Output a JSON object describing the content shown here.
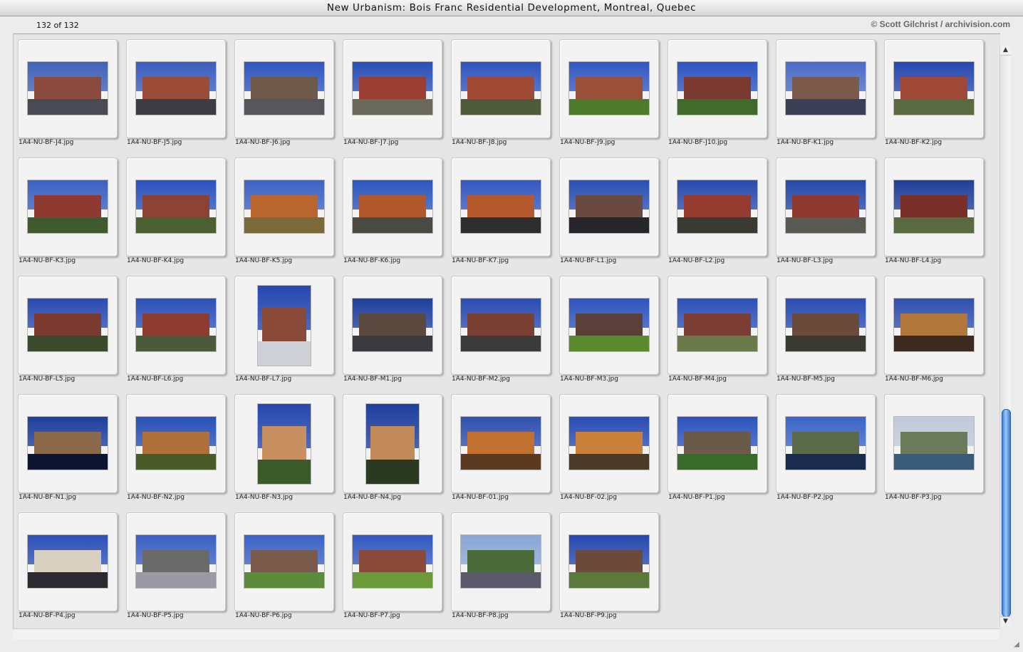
{
  "window": {
    "title": "New Urbanism: Bois Franc Residential Development, Montreal, Quebec"
  },
  "info": {
    "count": "132 of 132",
    "credit": "© Scott Gilchrist / archivision.com"
  },
  "thumbnails": [
    {
      "name": "1A4-NU-BF-J4.jpg",
      "sky": "#3f62b8",
      "bld": "#8a4a3c",
      "grd": "#4a4a55",
      "o": "land"
    },
    {
      "name": "1A4-NU-BF-J5.jpg",
      "sky": "#3a5ec0",
      "bld": "#9a4c38",
      "grd": "#3c3c42",
      "o": "land"
    },
    {
      "name": "1A4-NU-BF-J6.jpg",
      "sky": "#2f56c0",
      "bld": "#6d5a4a",
      "grd": "#55555a",
      "o": "land"
    },
    {
      "name": "1A4-NU-BF-J7.jpg",
      "sky": "#2a4fb5",
      "bld": "#9b3f32",
      "grd": "#6a6a5a",
      "o": "land"
    },
    {
      "name": "1A4-NU-BF-J8.jpg",
      "sky": "#2e55bf",
      "bld": "#a04a35",
      "grd": "#4e5a3a",
      "o": "land"
    },
    {
      "name": "1A4-NU-BF-J9.jpg",
      "sky": "#3358c2",
      "bld": "#9a5038",
      "grd": "#4f7a2e",
      "o": "land"
    },
    {
      "name": "1A4-NU-BF-J10.jpg",
      "sky": "#2c55c4",
      "bld": "#7a3a30",
      "grd": "#3f6a2a",
      "o": "land"
    },
    {
      "name": "1A4-NU-BF-K1.jpg",
      "sky": "#4a6cc8",
      "bld": "#7a5a4a",
      "grd": "#3b3f55",
      "o": "land"
    },
    {
      "name": "1A4-NU-BF-K2.jpg",
      "sky": "#2548b0",
      "bld": "#a04836",
      "grd": "#5a6a40",
      "o": "land"
    },
    {
      "name": "1A4-NU-BF-K3.jpg",
      "sky": "#3a60c4",
      "bld": "#8e3a30",
      "grd": "#3e5a2e",
      "o": "land"
    },
    {
      "name": "1A4-NU-BF-K4.jpg",
      "sky": "#2b52bd",
      "bld": "#8a4234",
      "grd": "#4a6032",
      "o": "land"
    },
    {
      "name": "1A4-NU-BF-K5.jpg",
      "sky": "#3c62c6",
      "bld": "#b8662e",
      "grd": "#7a6a3a",
      "o": "land"
    },
    {
      "name": "1A4-NU-BF-K6.jpg",
      "sky": "#2e56c0",
      "bld": "#b0582a",
      "grd": "#4a4a45",
      "o": "land"
    },
    {
      "name": "1A4-NU-BF-K7.jpg",
      "sky": "#3358c2",
      "bld": "#b45a2c",
      "grd": "#2e2e30",
      "o": "land"
    },
    {
      "name": "1A4-NU-BF-L1.jpg",
      "sky": "#2b4fb5",
      "bld": "#6a4a40",
      "grd": "#26262a",
      "o": "land"
    },
    {
      "name": "1A4-NU-BF-L2.jpg",
      "sky": "#2a4ab0",
      "bld": "#953a2e",
      "grd": "#3a3a35",
      "o": "land"
    },
    {
      "name": "1A4-NU-BF-L3.jpg",
      "sky": "#2548a8",
      "bld": "#8e3a30",
      "grd": "#5a5a55",
      "o": "land"
    },
    {
      "name": "1A4-NU-BF-L4.jpg",
      "sky": "#203f9a",
      "bld": "#7a2e28",
      "grd": "#5a6a40",
      "o": "land"
    },
    {
      "name": "1A4-NU-BF-L5.jpg",
      "sky": "#2a4ab2",
      "bld": "#7a3a30",
      "grd": "#3a4a2a",
      "o": "land"
    },
    {
      "name": "1A4-NU-BF-L6.jpg",
      "sky": "#2c50ba",
      "bld": "#8e3c30",
      "grd": "#4a5a3a",
      "o": "land"
    },
    {
      "name": "1A4-NU-BF-L7.jpg",
      "sky": "#2548b0",
      "bld": "#8a4a3a",
      "grd": "#cfcfd6",
      "o": "port"
    },
    {
      "name": "1A4-NU-BF-M1.jpg",
      "sky": "#1f3f9e",
      "bld": "#5a4a40",
      "grd": "#3a3a3e",
      "o": "land"
    },
    {
      "name": "1A4-NU-BF-M2.jpg",
      "sky": "#2a4cb2",
      "bld": "#7a4034",
      "grd": "#3a3a3a",
      "o": "land"
    },
    {
      "name": "1A4-NU-BF-M3.jpg",
      "sky": "#2e55bf",
      "bld": "#5a4038",
      "grd": "#5a8a2e",
      "o": "land"
    },
    {
      "name": "1A4-NU-BF-M4.jpg",
      "sky": "#2b50b8",
      "bld": "#7a3e34",
      "grd": "#6a7a4a",
      "o": "land"
    },
    {
      "name": "1A4-NU-BF-M5.jpg",
      "sky": "#2a4cb4",
      "bld": "#6a4a3a",
      "grd": "#3a3a30",
      "o": "land"
    },
    {
      "name": "1A4-NU-BF-M6.jpg",
      "sky": "#3050b0",
      "bld": "#b0783a",
      "grd": "#3a2a20",
      "o": "land"
    },
    {
      "name": "1A4-NU-BF-N1.jpg",
      "sky": "#1e3e9e",
      "bld": "#8a6a4a",
      "grd": "#0e1530",
      "o": "land"
    },
    {
      "name": "1A4-NU-BF-N2.jpg",
      "sky": "#2850b8",
      "bld": "#b0703a",
      "grd": "#4a5a2a",
      "o": "land"
    },
    {
      "name": "1A4-NU-BF-N3.jpg",
      "sky": "#2548b0",
      "bld": "#c89060",
      "grd": "#3a5a2a",
      "o": "port"
    },
    {
      "name": "1A4-NU-BF-N4.jpg",
      "sky": "#1e3f9e",
      "bld": "#c08a5a",
      "grd": "#2a3a20",
      "o": "port"
    },
    {
      "name": "1A4-NU-BF-01.jpg",
      "sky": "#3050b0",
      "bld": "#c07030",
      "grd": "#5a3a20",
      "o": "land"
    },
    {
      "name": "1A4-NU-BF-02.jpg",
      "sky": "#2a4cb4",
      "bld": "#c8803a",
      "grd": "#4a3a2a",
      "o": "land"
    },
    {
      "name": "1A4-NU-BF-P1.jpg",
      "sky": "#2c54be",
      "bld": "#6a5a4a",
      "grd": "#3a6a2a",
      "o": "land"
    },
    {
      "name": "1A4-NU-BF-P2.jpg",
      "sky": "#3a64c8",
      "bld": "#5a6a4a",
      "grd": "#1a2a4a",
      "o": "land"
    },
    {
      "name": "1A4-NU-BF-P3.jpg",
      "sky": "#c0cad8",
      "bld": "#6a7a5a",
      "grd": "#3a5a7a",
      "o": "land"
    },
    {
      "name": "1A4-NU-BF-P4.jpg",
      "sky": "#2c50ba",
      "bld": "#d8d0c0",
      "grd": "#2a2a30",
      "o": "land"
    },
    {
      "name": "1A4-NU-BF-P5.jpg",
      "sky": "#3a60c4",
      "bld": "#6a6a6a",
      "grd": "#9a9aa4",
      "o": "land"
    },
    {
      "name": "1A4-NU-BF-P6.jpg",
      "sky": "#3c62c6",
      "bld": "#7a5a4a",
      "grd": "#5a8a3a",
      "o": "land"
    },
    {
      "name": "1A4-NU-BF-P7.jpg",
      "sky": "#3358c2",
      "bld": "#8a4a3a",
      "grd": "#6a9a3a",
      "o": "land"
    },
    {
      "name": "1A4-NU-BF-P8.jpg",
      "sky": "#8aa6d6",
      "bld": "#4a6a3a",
      "grd": "#5a5a6a",
      "o": "land"
    },
    {
      "name": "1A4-NU-BF-P9.jpg",
      "sky": "#2848b0",
      "bld": "#6a4a3a",
      "grd": "#5a7a3a",
      "o": "land"
    }
  ]
}
